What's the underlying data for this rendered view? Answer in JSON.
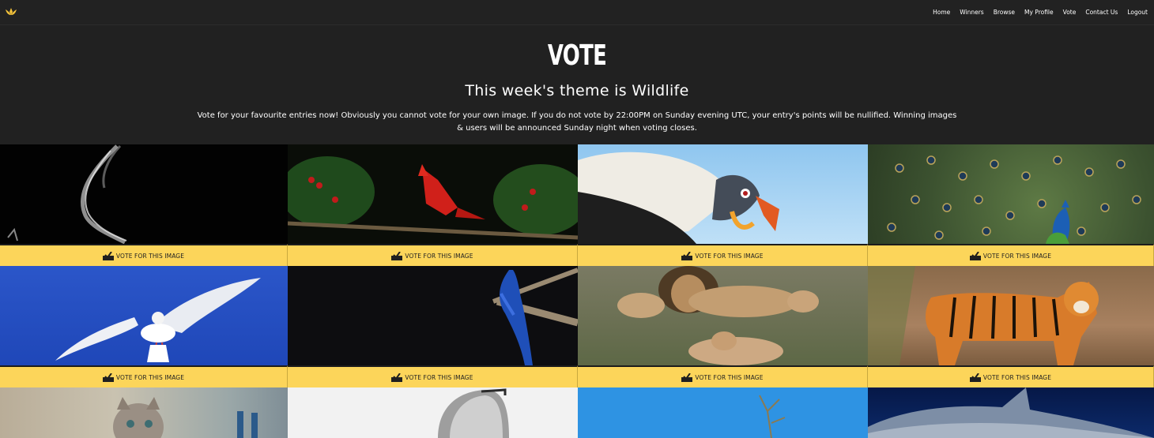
{
  "nav": {
    "logo_icon": "lotus-logo-icon",
    "links": [
      "Home",
      "Winners",
      "Browse",
      "My Profile",
      "Vote",
      "Contact Us",
      "Logout"
    ]
  },
  "header": {
    "title": "VOTE",
    "subtitle": "This week's theme is Wildlife",
    "intro": "Vote for your favourite entries now! Obviously you cannot vote for your own image. If you do not vote by 22:00PM on Sunday evening UTC, your entry's points will be nullified. Winning images & users will be announced Sunday night when voting closes."
  },
  "vote_label": "VOTE FOR THIS IMAGE",
  "vote_icon": "ballot-box-check-icon",
  "colors": {
    "accent": "#fcd55a",
    "background": "#212121"
  },
  "images": [
    {
      "name": "splash-image"
    },
    {
      "name": "cardinal-image"
    },
    {
      "name": "vulture-image"
    },
    {
      "name": "peacock-image"
    },
    {
      "name": "seagull-image"
    },
    {
      "name": "macaw-image"
    },
    {
      "name": "lions-image"
    },
    {
      "name": "tiger-image"
    },
    {
      "name": "kitten-image"
    },
    {
      "name": "horse-image"
    },
    {
      "name": "branch-sky-image"
    },
    {
      "name": "dolphin-image"
    }
  ]
}
